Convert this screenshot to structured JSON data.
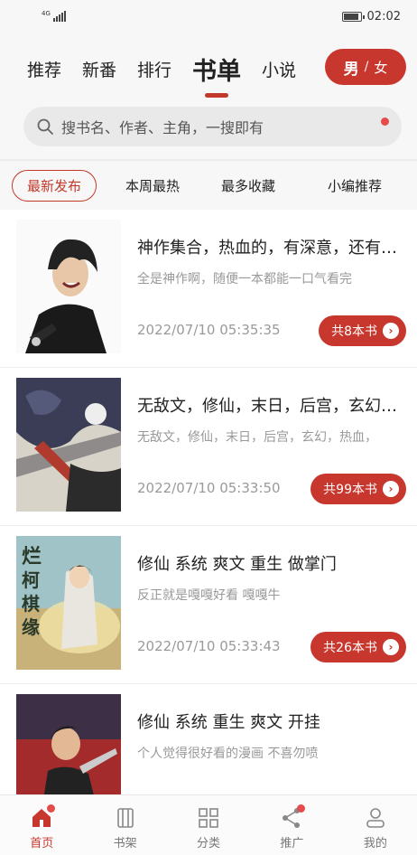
{
  "status_bar": {
    "network": "4G",
    "time": "02:02"
  },
  "top_tabs": [
    {
      "label": "推荐"
    },
    {
      "label": "新番"
    },
    {
      "label": "排行"
    },
    {
      "label": "书单",
      "active": true
    },
    {
      "label": "小说"
    }
  ],
  "gender_toggle": {
    "male": "男",
    "separator": "/",
    "female": "女"
  },
  "search": {
    "placeholder": "搜书名、作者、主角，一搜即有"
  },
  "filters": [
    "最新发布",
    "本周最热",
    "最多收藏",
    "小编推荐"
  ],
  "book_lists": [
    {
      "title": "神作集合，热血的，有深意，还有…",
      "desc": "全是神作啊，随便一本都能一口气看完",
      "time": "2022/07/10 05:35:35",
      "count": "共8本书"
    },
    {
      "title": "无敌文，修仙，末日，后宫，玄幻…",
      "desc": "无敌文，修仙，末日，后宫，玄幻，热血，",
      "time": "2022/07/10 05:33:50",
      "count": "共99本书"
    },
    {
      "title": "修仙 系统 爽文 重生 做掌门",
      "desc": "反正就是嘎嘎好看 嘎嘎牛",
      "time": "2022/07/10 05:33:43",
      "count": "共26本书"
    },
    {
      "title": "修仙 系统  重生 爽文  开挂",
      "desc": "个人觉得很好看的漫画 不喜勿喷",
      "time": "",
      "count": ""
    }
  ],
  "bottom_nav": [
    {
      "label": "首页",
      "icon": "home-icon",
      "active": true,
      "badge": true
    },
    {
      "label": "书架",
      "icon": "bookshelf-icon"
    },
    {
      "label": "分类",
      "icon": "category-icon"
    },
    {
      "label": "推广",
      "icon": "share-icon",
      "badge": true
    },
    {
      "label": "我的",
      "icon": "user-icon"
    }
  ],
  "colors": {
    "accent": "#c8372d",
    "badge": "#e54b4b"
  }
}
